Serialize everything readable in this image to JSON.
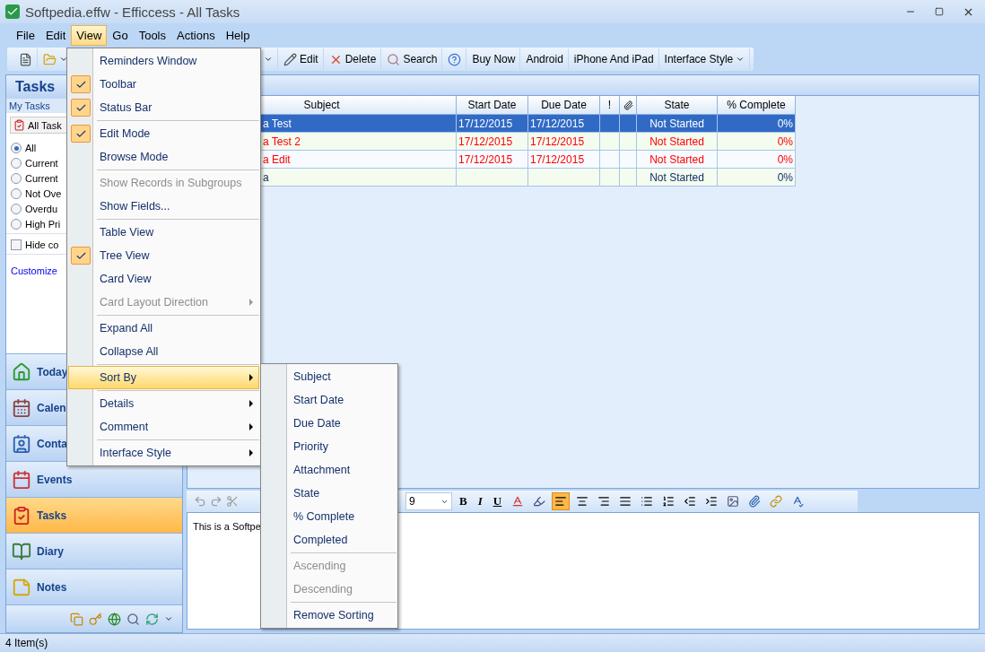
{
  "window": {
    "title": "Softpedia.effw - Efficcess - All Tasks"
  },
  "menubar": [
    {
      "label": "File",
      "selected": false
    },
    {
      "label": "Edit",
      "selected": false
    },
    {
      "label": "View",
      "selected": true
    },
    {
      "label": "Go",
      "selected": false
    },
    {
      "label": "Tools",
      "selected": false
    },
    {
      "label": "Actions",
      "selected": false
    },
    {
      "label": "Help",
      "selected": false
    }
  ],
  "toolbar": [
    {
      "kind": "icon"
    },
    {
      "kind": "icon_dropdown"
    },
    {
      "kind": "caret"
    },
    {
      "kind": "icon_text",
      "label": "Edit"
    },
    {
      "kind": "icon_text",
      "label": "Delete"
    },
    {
      "kind": "icon_text",
      "label": "Search"
    },
    {
      "kind": "icon"
    },
    {
      "kind": "text",
      "label": "Buy Now"
    },
    {
      "kind": "text",
      "label": "Android"
    },
    {
      "kind": "text",
      "label": "iPhone And iPad"
    },
    {
      "kind": "text_dropdown",
      "label": "Interface Style"
    }
  ],
  "sidebar": {
    "title": "Tasks",
    "subtitle": "My Tasks",
    "view_picker": "All Task",
    "filters": [
      {
        "label": "All",
        "selected": true
      },
      {
        "label": "Current",
        "selected": false
      },
      {
        "label": "Current",
        "selected": false
      },
      {
        "label": "Not Ove",
        "selected": false
      },
      {
        "label": "Overdu",
        "selected": false
      },
      {
        "label": "High Pri",
        "selected": false
      }
    ],
    "hide_completed": {
      "label": "Hide co",
      "checked": false
    },
    "customize_link": "Customize",
    "nav": [
      {
        "label": "Today",
        "selected": false
      },
      {
        "label": "Calen",
        "selected": false
      },
      {
        "label": "Conta",
        "selected": false
      },
      {
        "label": "Events",
        "selected": false
      },
      {
        "label": "Tasks",
        "selected": true
      },
      {
        "label": "Diary",
        "selected": false
      },
      {
        "label": "Notes",
        "selected": false
      }
    ]
  },
  "table": {
    "columns": [
      {
        "kind": "text",
        "label": "Subject"
      },
      {
        "kind": "text",
        "label": "Start Date"
      },
      {
        "kind": "text",
        "label": "Due Date"
      },
      {
        "kind": "text",
        "label": "!"
      },
      {
        "kind": "attachment"
      },
      {
        "kind": "text",
        "label": "State"
      },
      {
        "kind": "text",
        "label": "% Complete"
      }
    ],
    "rows": [
      {
        "subject": "a Test",
        "start": "17/12/2015",
        "due": "17/12/2015",
        "state": "Not Started",
        "complete": "0%",
        "overdue": true,
        "selected": true
      },
      {
        "subject": "a Test 2",
        "start": "17/12/2015",
        "due": "17/12/2015",
        "state": "Not Started",
        "complete": "0%",
        "overdue": true,
        "selected": false
      },
      {
        "subject": "a Edit",
        "start": "17/12/2015",
        "due": "17/12/2015",
        "state": "Not Started",
        "complete": "0%",
        "overdue": true,
        "selected": false
      },
      {
        "subject": "a",
        "start": "",
        "due": "",
        "state": "Not Started",
        "complete": "0%",
        "overdue": false,
        "selected": false
      }
    ]
  },
  "editor": {
    "font_size": "9",
    "bold": "B",
    "italic": "I",
    "underline": "U",
    "align_buttons": [
      {
        "selected": true
      },
      {
        "selected": false
      },
      {
        "selected": false
      },
      {
        "selected": false
      }
    ],
    "text": "This is a Softpe"
  },
  "view_menu": [
    {
      "kind": "item",
      "label": "Reminders Window",
      "checked": false,
      "disabled": false,
      "submenu": false,
      "selected": false
    },
    {
      "kind": "item",
      "label": "Toolbar",
      "checked": true,
      "disabled": false,
      "submenu": false,
      "selected": false
    },
    {
      "kind": "item",
      "label": "Status Bar",
      "checked": true,
      "disabled": false,
      "submenu": false,
      "selected": false
    },
    {
      "kind": "separator"
    },
    {
      "kind": "item",
      "label": "Edit Mode",
      "checked": true,
      "disabled": false,
      "submenu": false,
      "selected": false
    },
    {
      "kind": "item",
      "label": "Browse Mode",
      "checked": false,
      "disabled": false,
      "submenu": false,
      "selected": false
    },
    {
      "kind": "separator"
    },
    {
      "kind": "item",
      "label": "Show Records in Subgroups",
      "checked": false,
      "disabled": true,
      "submenu": false,
      "selected": false
    },
    {
      "kind": "item",
      "label": "Show Fields...",
      "checked": false,
      "disabled": false,
      "submenu": false,
      "selected": false
    },
    {
      "kind": "separator"
    },
    {
      "kind": "item",
      "label": "Table View",
      "checked": false,
      "disabled": false,
      "submenu": false,
      "selected": false
    },
    {
      "kind": "item",
      "label": "Tree View",
      "checked": true,
      "disabled": false,
      "submenu": false,
      "selected": false
    },
    {
      "kind": "item",
      "label": "Card View",
      "checked": false,
      "disabled": false,
      "submenu": false,
      "selected": false
    },
    {
      "kind": "item",
      "label": "Card Layout Direction",
      "checked": false,
      "disabled": true,
      "submenu": true,
      "selected": false
    },
    {
      "kind": "separator"
    },
    {
      "kind": "item",
      "label": "Expand All",
      "checked": false,
      "disabled": false,
      "submenu": false,
      "selected": false
    },
    {
      "kind": "item",
      "label": "Collapse All",
      "checked": false,
      "disabled": false,
      "submenu": false,
      "selected": false
    },
    {
      "kind": "separator"
    },
    {
      "kind": "item",
      "label": "Sort By",
      "checked": false,
      "disabled": false,
      "submenu": true,
      "selected": true
    },
    {
      "kind": "separator"
    },
    {
      "kind": "item",
      "label": "Details",
      "checked": false,
      "disabled": false,
      "submenu": true,
      "selected": false
    },
    {
      "kind": "item",
      "label": "Comment",
      "checked": false,
      "disabled": false,
      "submenu": true,
      "selected": false
    },
    {
      "kind": "separator"
    },
    {
      "kind": "item",
      "label": "Interface Style",
      "checked": false,
      "disabled": false,
      "submenu": true,
      "selected": false
    }
  ],
  "sort_menu": [
    {
      "kind": "item",
      "label": "Subject",
      "checked": false,
      "disabled": false,
      "submenu": false,
      "selected": false
    },
    {
      "kind": "item",
      "label": "Start Date",
      "checked": false,
      "disabled": false,
      "submenu": false,
      "selected": false
    },
    {
      "kind": "item",
      "label": "Due Date",
      "checked": false,
      "disabled": false,
      "submenu": false,
      "selected": false
    },
    {
      "kind": "item",
      "label": "Priority",
      "checked": false,
      "disabled": false,
      "submenu": false,
      "selected": false
    },
    {
      "kind": "item",
      "label": "Attachment",
      "checked": false,
      "disabled": false,
      "submenu": false,
      "selected": false
    },
    {
      "kind": "item",
      "label": "State",
      "checked": false,
      "disabled": false,
      "submenu": false,
      "selected": false
    },
    {
      "kind": "item",
      "label": "% Complete",
      "checked": false,
      "disabled": false,
      "submenu": false,
      "selected": false
    },
    {
      "kind": "item",
      "label": "Completed",
      "checked": false,
      "disabled": false,
      "submenu": false,
      "selected": false
    },
    {
      "kind": "separator"
    },
    {
      "kind": "item",
      "label": "Ascending",
      "checked": false,
      "disabled": true,
      "submenu": false,
      "selected": false
    },
    {
      "kind": "item",
      "label": "Descending",
      "checked": false,
      "disabled": true,
      "submenu": false,
      "selected": false
    },
    {
      "kind": "separator"
    },
    {
      "kind": "item",
      "label": "Remove Sorting",
      "checked": false,
      "disabled": false,
      "submenu": false,
      "selected": false
    }
  ],
  "status_bar": "4 Item(s)"
}
